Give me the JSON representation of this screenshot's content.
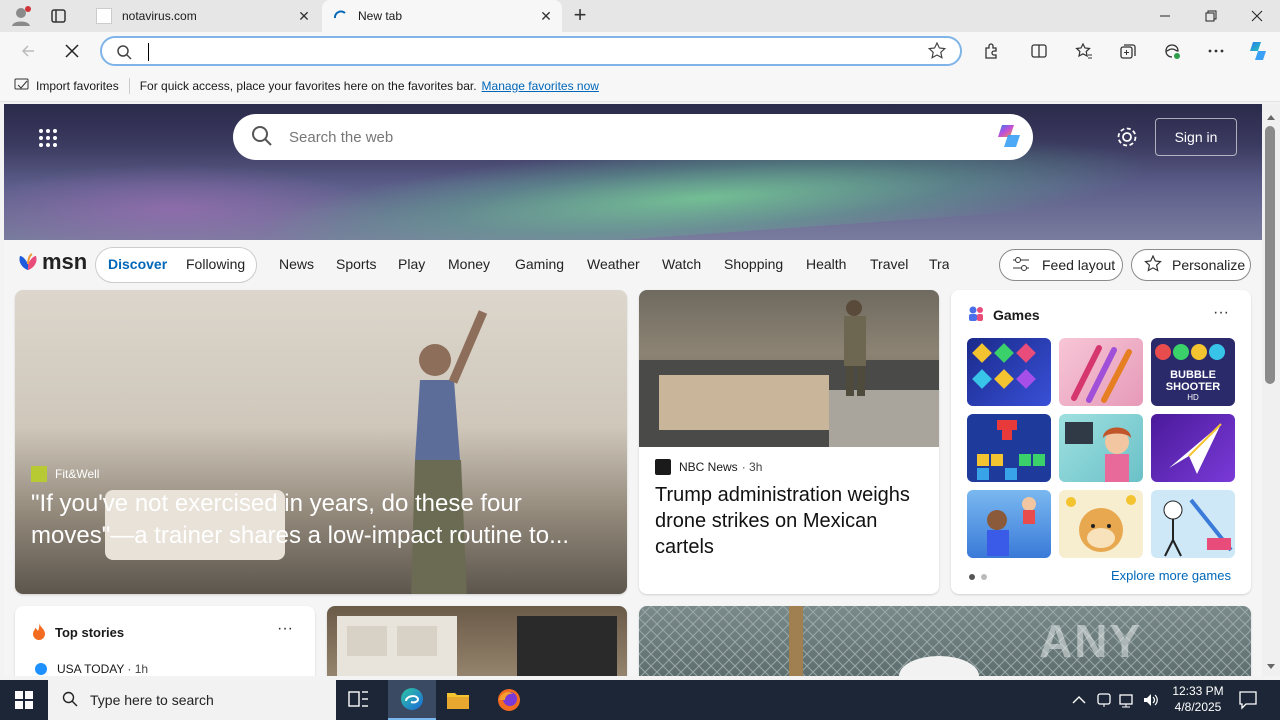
{
  "tabs": [
    {
      "title": "notavirus.com",
      "active": false
    },
    {
      "title": "New tab",
      "active": true
    }
  ],
  "address_bar": {
    "value": "",
    "placeholder": ""
  },
  "favorites_bar": {
    "import_label": "Import favorites",
    "hint": "For quick access, place your favorites here on the favorites bar.",
    "manage_link": "Manage favorites now"
  },
  "msn": {
    "search_placeholder": "Search the web",
    "sign_in": "Sign in",
    "logo": "msn",
    "toggle": {
      "discover": "Discover",
      "following": "Following"
    },
    "nav": [
      "News",
      "Sports",
      "Play",
      "Money",
      "Gaming",
      "Weather",
      "Watch",
      "Shopping",
      "Health",
      "Travel",
      "Tra"
    ],
    "feed_layout": "Feed layout",
    "personalize": "Personalize"
  },
  "hero_story": {
    "source": "Fit&Well",
    "headline": "\"If you've not exercised in years, do these four moves\"—a trainer shares a low-impact routine to..."
  },
  "side_story": {
    "source": "NBC News",
    "age": "· 3h",
    "headline": "Trump administration weighs drone strikes on Mexican cartels"
  },
  "games": {
    "title": "Games",
    "explore": "Explore more games",
    "tiles": [
      "Jewel match",
      "Makeup brushes",
      "Bubble Shooter HD",
      "Block puzzle",
      "Hospital story",
      "Paper plane",
      "Cafe game",
      "Doge puzzle",
      "Thief puzzle"
    ],
    "bubble_text": "BUBBLE SHOOTER",
    "bubble_sub": "HD"
  },
  "top_stories": {
    "title": "Top stories",
    "source": "USA TODAY",
    "age": "· 1h"
  },
  "watermark": "ANY RUN",
  "taskbar": {
    "search_placeholder": "Type here to search",
    "time": "12:33 PM",
    "date": "4/8/2025"
  },
  "colors": {
    "accent": "#0067b8",
    "taskbar": "#1c2636"
  }
}
